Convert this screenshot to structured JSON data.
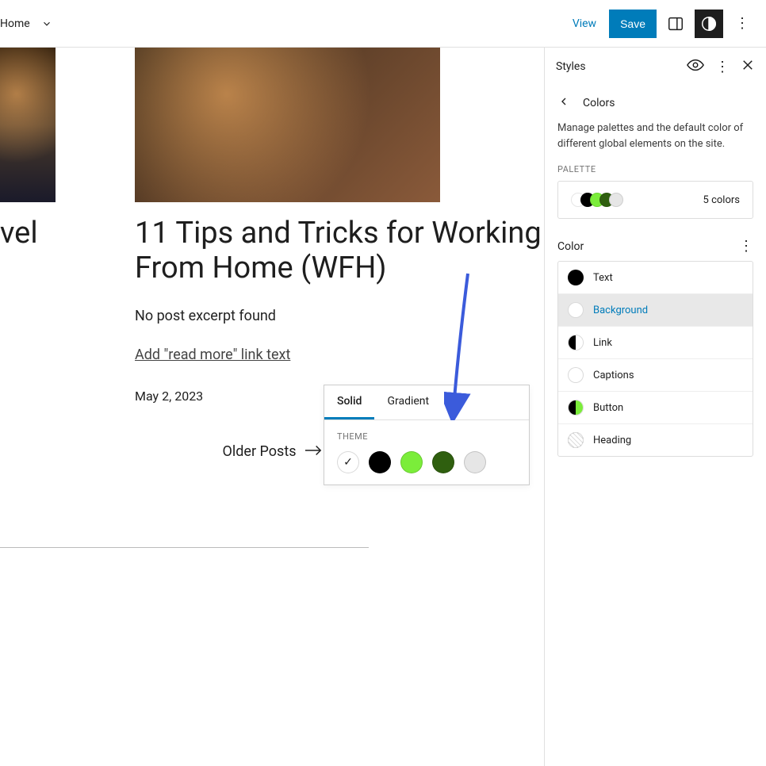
{
  "topbar": {
    "home": "Home",
    "view": "View",
    "save": "Save"
  },
  "canvas": {
    "left_post_title": "vel",
    "post_title": "11 Tips and Tricks for Working From Home (WFH)",
    "excerpt": "No post excerpt found",
    "read_more": "Add \"read more\" link text",
    "date": "May 2, 2023",
    "older_posts": "Older Posts"
  },
  "popover": {
    "tabs": {
      "solid": "Solid",
      "gradient": "Gradient"
    },
    "theme_label": "THEME",
    "swatches": [
      "#ffffff",
      "#000000",
      "#7bed3a",
      "#2f5f0f",
      "#e6e6e6"
    ],
    "selected_index": 0
  },
  "sidebar": {
    "title": "Styles",
    "breadcrumb": "Colors",
    "description": "Manage palettes and the default color of different global elements on the site.",
    "palette_label": "PALETTE",
    "palette_count": "5 colors",
    "palette_colors": [
      "#ffffff",
      "#000000",
      "#7bed3a",
      "#2f5f0f",
      "#e6e6e6"
    ],
    "color_label": "Color",
    "elements": [
      {
        "name": "Text",
        "type": "solid",
        "color": "#000000"
      },
      {
        "name": "Background",
        "type": "empty",
        "active": true
      },
      {
        "name": "Link",
        "type": "split",
        "left": "#000000",
        "right": "#ffffff"
      },
      {
        "name": "Captions",
        "type": "empty"
      },
      {
        "name": "Button",
        "type": "split",
        "left": "#000000",
        "right": "#7bed3a"
      },
      {
        "name": "Heading",
        "type": "hatch"
      }
    ]
  }
}
